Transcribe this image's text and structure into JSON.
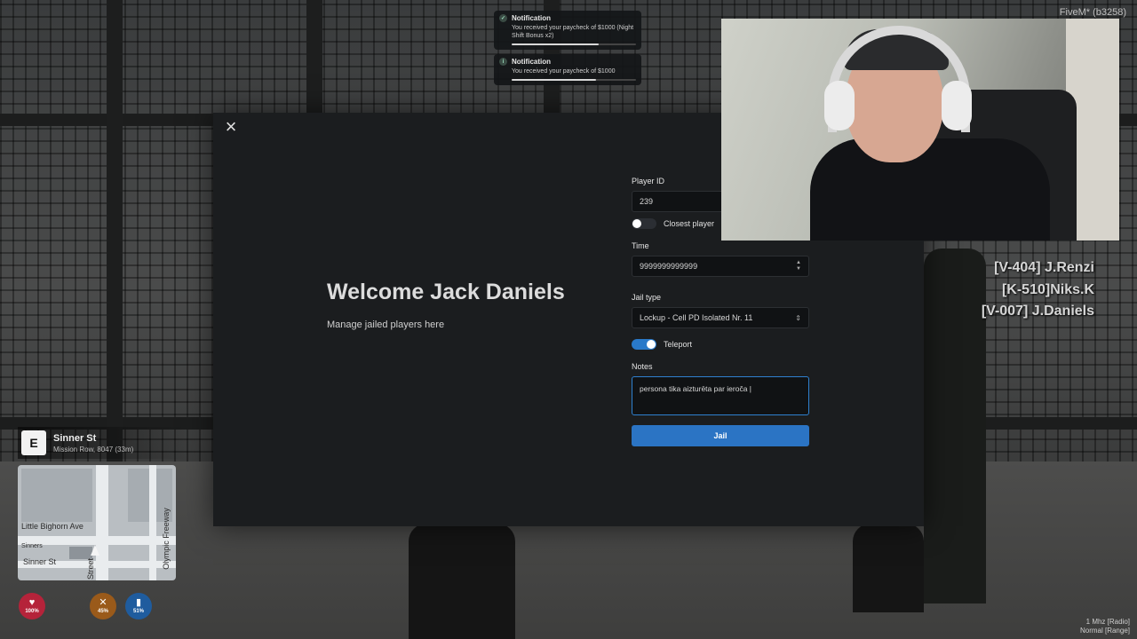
{
  "server": {
    "label": "FiveM* (b3258)"
  },
  "notifications": [
    {
      "title": "Notification",
      "message": "You received your paycheck of $1000 (Night Shift Bonus x2)",
      "progress": 0.7
    },
    {
      "title": "Notification",
      "message": "You received your paycheck of $1000",
      "progress": 0.68
    }
  ],
  "modal": {
    "welcome": "Welcome Jack Daniels",
    "subtitle": "Manage jailed players here",
    "player_id_label": "Player ID",
    "player_id_value": "239",
    "closest_player_label": "Closest player",
    "closest_player_on": false,
    "time_label": "Time",
    "time_value": "9999999999999",
    "jail_type_label": "Jail type",
    "jail_type_value": "Lockup - Cell PD Isolated Nr. 11",
    "teleport_label": "Teleport",
    "teleport_on": true,
    "notes_label": "Notes",
    "notes_value": "persona tika aizturēta par ieroča |",
    "jail_button": "Jail"
  },
  "player_tags": [
    "[V-404] J.Renzi",
    "[K-510]Niks.K",
    "[V-007] J.Daniels"
  ],
  "location": {
    "compass": "E",
    "street": "Sinner St",
    "area": "Mission Row, 8047",
    "distance": "(33m)"
  },
  "map_labels": {
    "a": "Little Bighorn Ave",
    "b": "Sinner St",
    "c": "Street",
    "d": "Olympic Freeway",
    "e": "Sinners"
  },
  "status": [
    {
      "name": "health",
      "value": "100%",
      "color": "#b5233a",
      "glyph": "♥"
    },
    {
      "name": "hunger",
      "value": "45%",
      "color": "#9a5a1a",
      "glyph": "🍴"
    },
    {
      "name": "thirst",
      "value": "51%",
      "color": "#1f5c9e",
      "glyph": "▮"
    }
  ],
  "radio": {
    "line1": "1 Mhz [Radio]",
    "line2": "Normal [Range]"
  }
}
